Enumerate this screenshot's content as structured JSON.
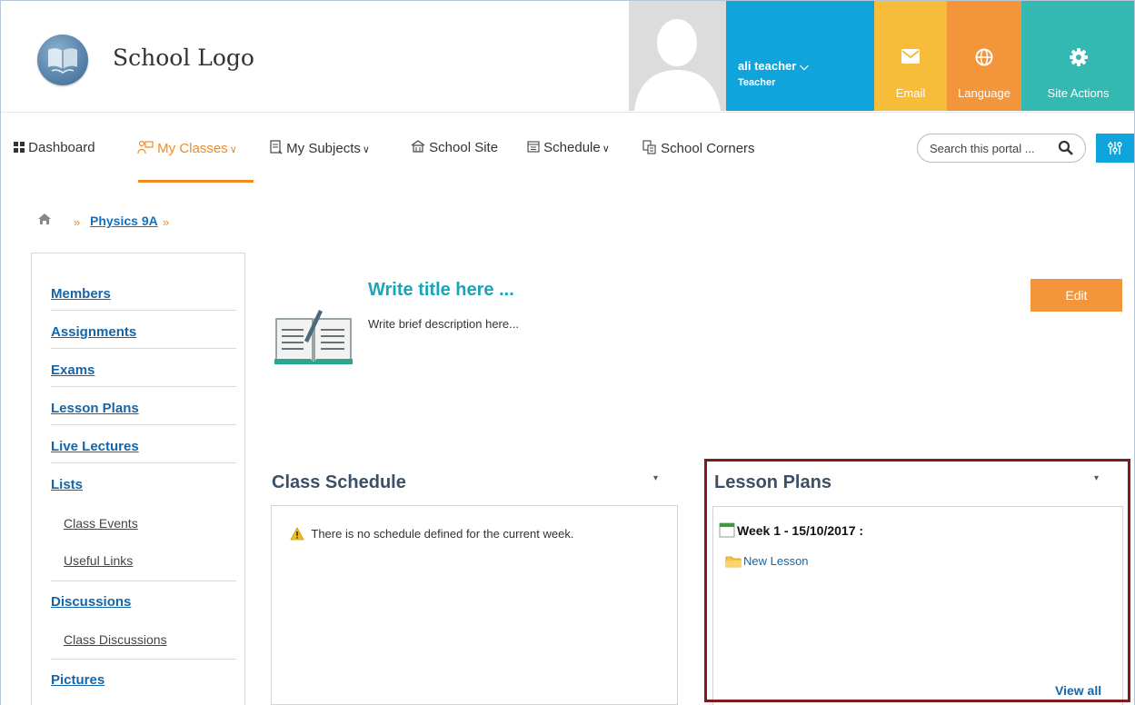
{
  "header": {
    "logo_text": "School Logo",
    "user_name": "ali teacher",
    "user_role": "Teacher",
    "tiles": {
      "email": "Email",
      "language": "Language",
      "site_actions": "Site Actions"
    },
    "colors": {
      "user": "#10a4dd",
      "email": "#f7bd3a",
      "language": "#f3953b",
      "site_actions": "#33b9b2"
    }
  },
  "nav": {
    "items": [
      {
        "label": "Dashboard"
      },
      {
        "label": "My Classes"
      },
      {
        "label": "My Subjects"
      },
      {
        "label": "School Site"
      },
      {
        "label": "Schedule"
      },
      {
        "label": "School Corners"
      }
    ],
    "active": "My Classes",
    "search_placeholder": "Search this portal ..."
  },
  "breadcrumb": {
    "current": "Physics 9A"
  },
  "sidebar": {
    "items": [
      {
        "label": "Members"
      },
      {
        "label": "Assignments"
      },
      {
        "label": "Exams"
      },
      {
        "label": "Lesson Plans"
      },
      {
        "label": "Live Lectures"
      },
      {
        "label": "Lists"
      },
      {
        "label": "Class Events"
      },
      {
        "label": "Useful Links"
      },
      {
        "label": "Discussions"
      },
      {
        "label": "Class Discussions"
      },
      {
        "label": "Pictures"
      }
    ]
  },
  "main": {
    "title": "Write title here ...",
    "description": "Write brief description here...",
    "edit_label": "Edit",
    "class_schedule": {
      "title": "Class Schedule",
      "message": "There is no schedule defined for the current week."
    },
    "lesson_plans": {
      "title": "Lesson Plans",
      "week": "Week 1 - 15/10/2017 :",
      "lesson": "New Lesson",
      "view_all": "View all"
    }
  }
}
